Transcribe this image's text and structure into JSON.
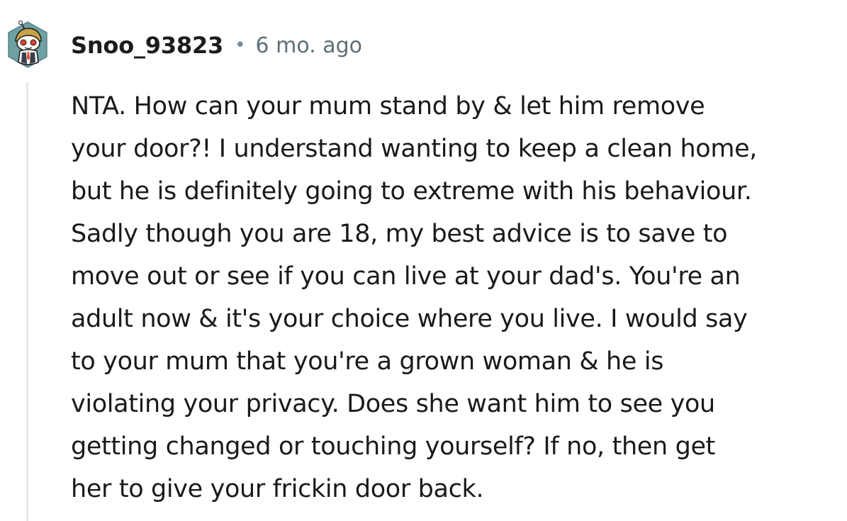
{
  "comment": {
    "author": "Snoo_93823",
    "separator": "•",
    "age": "6 mo. ago",
    "avatar_icon": "snoo-avatar-icon",
    "body_lines": [
      "NTA. How can your mum stand by & let him remove",
      "your door?! I understand wanting to keep a clean home,",
      "but he is definitely going to extreme with his behaviour.",
      "Sadly though you are 18, my best advice is to save to",
      "move out or see if you can live at your dad's. You're an",
      "adult now & it's your choice where you live. I would say",
      "to your mum that you're a grown woman & he is",
      "violating your privacy. Does she want him to see you",
      "getting changed or touching yourself? If no, then get",
      "her to give your frickin door back."
    ]
  },
  "colors": {
    "thread_line": "#e5e8ea",
    "meta_text": "#5f6f7a",
    "avatar_hex": "#6fa0a3"
  }
}
